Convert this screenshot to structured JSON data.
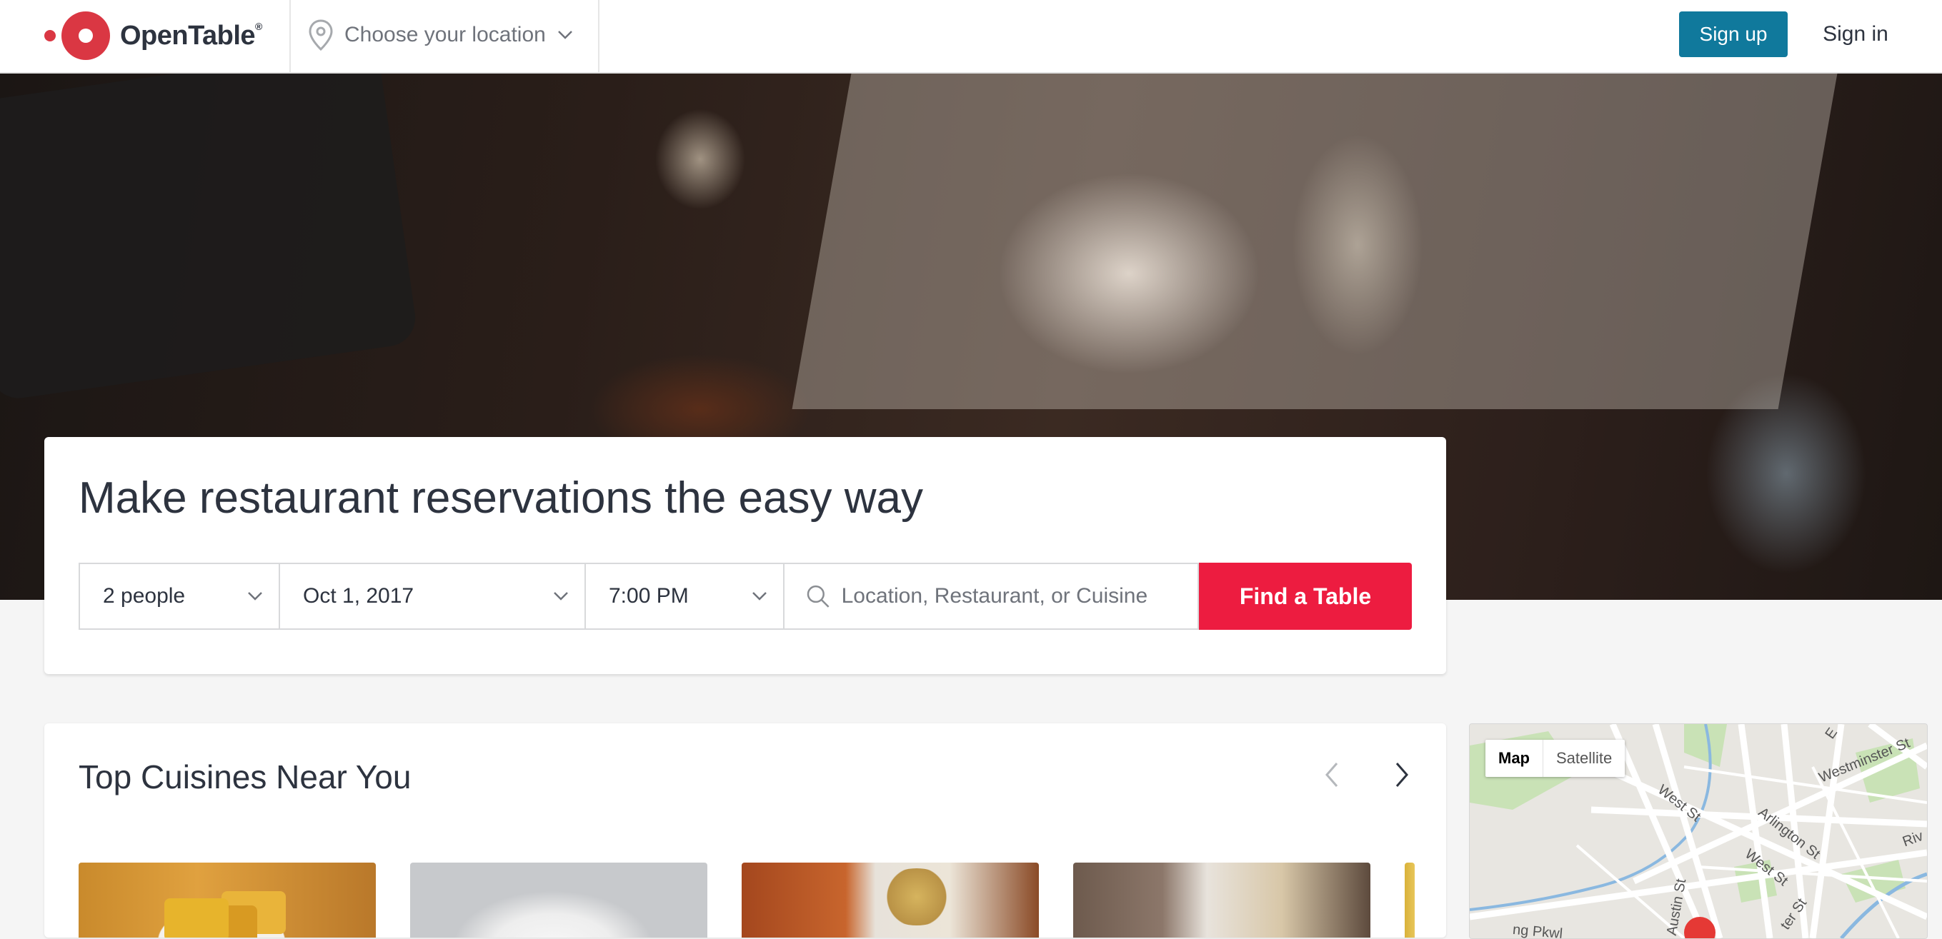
{
  "header": {
    "brand": "OpenTable",
    "brand_mark": "®",
    "location_label": "Choose your location",
    "signup_label": "Sign up",
    "signin_label": "Sign in"
  },
  "search": {
    "title": "Make restaurant reservations the easy way",
    "party_size": "2 people",
    "date": "Oct 1, 2017",
    "time": "7:00 PM",
    "query_placeholder": "Location, Restaurant, or Cuisine",
    "submit_label": "Find a Table"
  },
  "cuisines": {
    "title": "Top Cuisines Near You"
  },
  "map": {
    "map_label": "Map",
    "satellite_label": "Satellite",
    "streets": [
      "West St",
      "Arlington St",
      "West St",
      "Westminster St",
      "Austin St",
      "Riv",
      "E",
      "Er",
      "ng Pkwl",
      "ter St"
    ]
  },
  "colors": {
    "brand_red": "#da3743",
    "find_button": "#ed1c40",
    "signup_button": "#10799c"
  }
}
